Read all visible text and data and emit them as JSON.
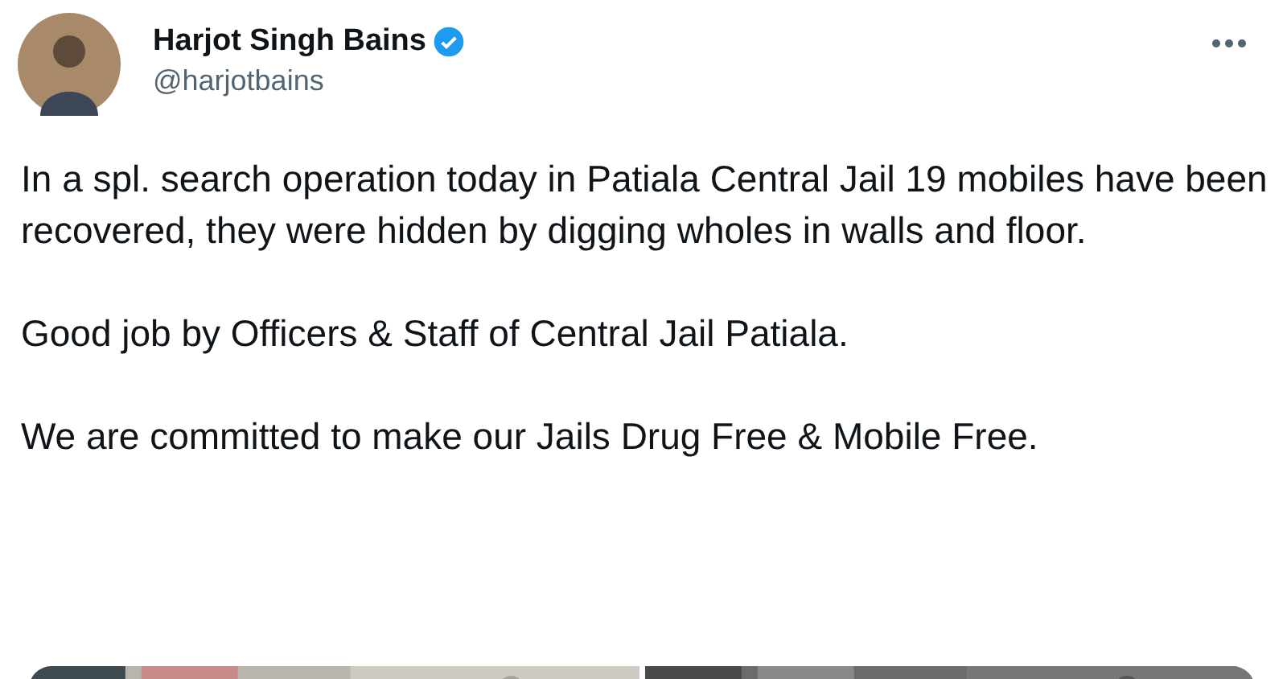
{
  "author": {
    "name": "Harjot Singh Bains",
    "verified": true,
    "handle": "@harjotbains"
  },
  "paragraphs": [
    "In a spl. search operation today in Patiala Central Jail 19 mobiles have been recovered, they were hidden by digging wholes in walls and floor.",
    "Good job by Officers & Staff of Central Jail Patiala.",
    "We are committed to make our Jails Drug Free & Mobile Free."
  ]
}
